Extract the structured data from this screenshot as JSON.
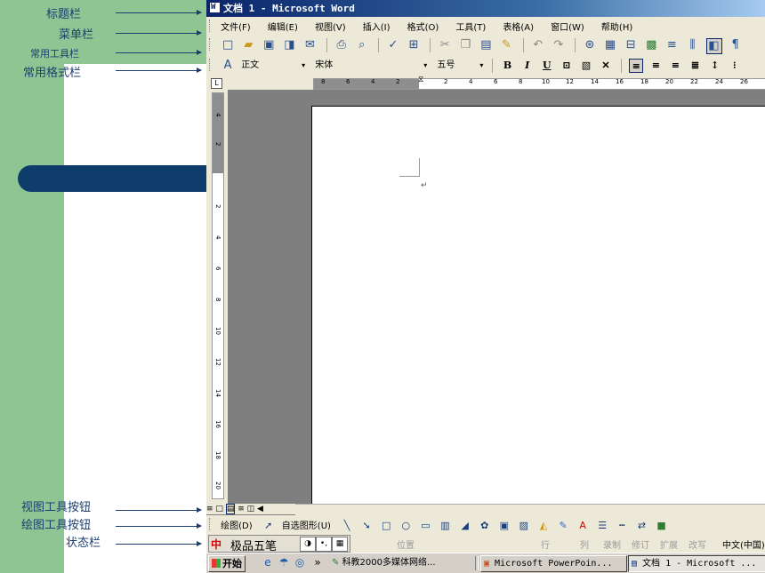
{
  "annotations": {
    "title_bar": "标题栏",
    "menu_bar": "菜单栏",
    "standard_toolbar": "常用工具栏",
    "formatting_toolbar": "常用格式栏",
    "view_buttons": "视图工具按钮",
    "drawing_buttons": "绘图工具按钮",
    "status_bar": "状态栏"
  },
  "window": {
    "title": "文档 1 - Microsoft Word"
  },
  "menu": [
    "文件(F)",
    "编辑(E)",
    "视图(V)",
    "插入(I)",
    "格式(O)",
    "工具(T)",
    "表格(A)",
    "窗口(W)",
    "帮助(H)"
  ],
  "formatting": {
    "style": "正文",
    "font": "宋体",
    "size": "五号",
    "bold": "B",
    "italic": "I",
    "underline": "U"
  },
  "ruler": {
    "h_left": [
      "8",
      "6",
      "4",
      "2"
    ],
    "h_right": [
      "2",
      "4",
      "6",
      "8",
      "10",
      "12",
      "14",
      "16",
      "18",
      "20",
      "22",
      "24",
      "26"
    ],
    "v": [
      "4",
      "2",
      "2",
      "4",
      "6",
      "8",
      "10",
      "12",
      "14",
      "16",
      "18",
      "20"
    ]
  },
  "drawing": {
    "draw_label": "绘图(D)",
    "autoshape_label": "自选图形(U)"
  },
  "status": {
    "ime_name": "极品五笔",
    "position": "位置",
    "line": "行",
    "column": "列",
    "record": "录制",
    "revise": "修订",
    "extend": "扩展",
    "overwrite": "改写",
    "language": "中文(中国)"
  },
  "taskbar": {
    "start": "开始",
    "items": [
      "科教2000多媒体网络...",
      "Microsoft PowerPoin...",
      "文档 1 - Microsoft ..."
    ]
  }
}
